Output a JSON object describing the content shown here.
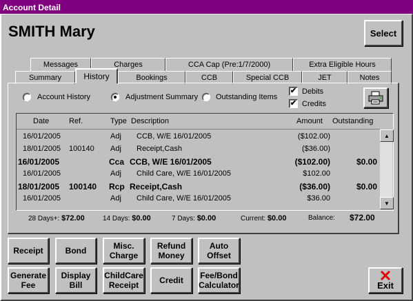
{
  "window": {
    "title": "Account Detail"
  },
  "header": {
    "name": "SMITH Mary",
    "select_label": "Select"
  },
  "tabs_top": [
    "Messages",
    "Charges",
    "CCA Cap (Pre:1/7/2000)",
    "Extra Eligible Hours"
  ],
  "tabs_bottom": [
    "Summary",
    "History",
    "Bookings",
    "CCB",
    "Special CCB",
    "JET",
    "Notes"
  ],
  "active_tab": "History",
  "options": {
    "account_history": "Account History",
    "adjustment_summary": "Adjustment Summary",
    "outstanding_items": "Outstanding Items",
    "selected": "Adjustment Summary",
    "debits_label": "Debits",
    "credits_label": "Credits",
    "debits_checked": "✔",
    "credits_checked": "✔"
  },
  "table": {
    "headers": {
      "date": "Date",
      "ref": "Ref.",
      "type": "Type",
      "description": "Description",
      "amount": "Amount",
      "outstanding": "Outstanding"
    },
    "rows": [
      {
        "date": "16/01/2005",
        "ref": "",
        "type": "Adj",
        "description": "CCB, W/E 16/01/2005",
        "amount": "($102.00)",
        "outstanding": "",
        "bold": false
      },
      {
        "date": "18/01/2005",
        "ref": "100140",
        "type": "Adj",
        "description": "Receipt,Cash",
        "amount": "($36.00)",
        "outstanding": "",
        "bold": false
      },
      {
        "date": "16/01/2005",
        "ref": "",
        "type": "Cca",
        "description": "CCB, W/E 16/01/2005",
        "amount": "($102.00)",
        "outstanding": "$0.00",
        "bold": true
      },
      {
        "date": "16/01/2005",
        "ref": "",
        "type": "Adj",
        "description": "Child Care, W/E 16/01/2005",
        "amount": "$102.00",
        "outstanding": "",
        "bold": false
      },
      {
        "date": "18/01/2005",
        "ref": "100140",
        "type": "Rcp",
        "description": "Receipt,Cash",
        "amount": "($36.00)",
        "outstanding": "$0.00",
        "bold": true
      },
      {
        "date": "16/01/2005",
        "ref": "",
        "type": "Adj",
        "description": "Child Care, W/E 16/01/2005",
        "amount": "$36.00",
        "outstanding": "",
        "bold": false
      }
    ]
  },
  "totals": {
    "days28_label": "28 Days+:",
    "days28_value": "$72.00",
    "days14_label": "14 Days:",
    "days14_value": "$0.00",
    "days7_label": "7 Days:",
    "days7_value": "$0.00",
    "current_label": "Current:",
    "current_value": "$0.00",
    "balance_label": "Balance:",
    "balance_value": "$72.00"
  },
  "buttons_row1": [
    "Receipt",
    "Bond",
    "Misc.\nCharge",
    "Refund\nMoney",
    "Auto\nOffset"
  ],
  "buttons_row2": [
    "Generate\nFee",
    "Display\nBill",
    "ChildCare\nReceipt",
    "Credit",
    "Fee/Bond\nCalculator"
  ],
  "exit_label": "Exit",
  "colors": {
    "titlebar": "#800080",
    "face": "#c0c0c0",
    "exit_icon": "#e00000"
  }
}
